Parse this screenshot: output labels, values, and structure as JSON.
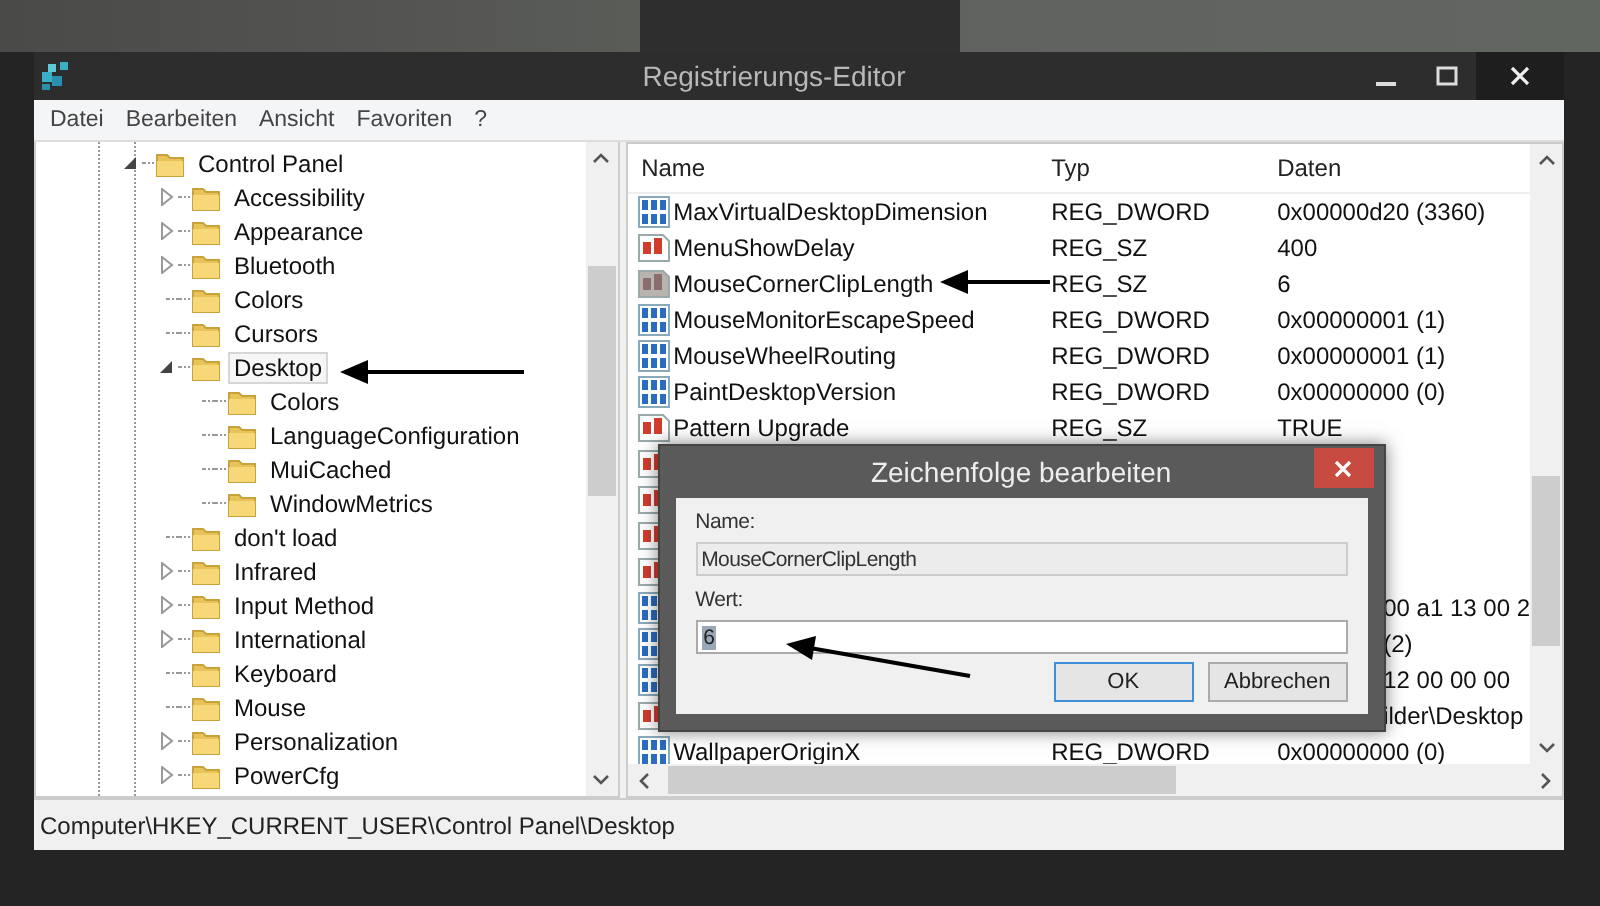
{
  "window": {
    "title": "Registrierungs-Editor"
  },
  "menu": [
    "Datei",
    "Bearbeiten",
    "Ansicht",
    "Favoriten",
    "?"
  ],
  "tree": [
    {
      "label": "Control Panel",
      "kind": "branch",
      "expanded": true,
      "selected": false,
      "children": [
        {
          "label": "Accessibility",
          "kind": "branch",
          "expanded": false,
          "selected": false
        },
        {
          "label": "Appearance",
          "kind": "branch",
          "expanded": false,
          "selected": false
        },
        {
          "label": "Bluetooth",
          "kind": "branch",
          "expanded": false,
          "selected": false
        },
        {
          "label": "Colors",
          "kind": "leaf",
          "selected": false
        },
        {
          "label": "Cursors",
          "kind": "leaf",
          "selected": false
        },
        {
          "label": "Desktop",
          "kind": "branch",
          "expanded": true,
          "selected": true,
          "children": [
            {
              "label": "Colors",
              "kind": "leaf",
              "selected": false
            },
            {
              "label": "LanguageConfiguration",
              "kind": "leaf",
              "selected": false
            },
            {
              "label": "MuiCached",
              "kind": "leaf",
              "selected": false
            },
            {
              "label": "WindowMetrics",
              "kind": "leaf",
              "selected": false
            }
          ]
        },
        {
          "label": "don't load",
          "kind": "leaf",
          "selected": false
        },
        {
          "label": "Infrared",
          "kind": "branch",
          "expanded": false,
          "selected": false
        },
        {
          "label": "Input Method",
          "kind": "branch",
          "expanded": false,
          "selected": false
        },
        {
          "label": "International",
          "kind": "branch",
          "expanded": false,
          "selected": false
        },
        {
          "label": "Keyboard",
          "kind": "leaf",
          "selected": false
        },
        {
          "label": "Mouse",
          "kind": "leaf",
          "selected": false
        },
        {
          "label": "Personalization",
          "kind": "branch",
          "expanded": false,
          "selected": false
        },
        {
          "label": "PowerCfg",
          "kind": "branch",
          "expanded": false,
          "selected": false
        }
      ]
    }
  ],
  "list": {
    "columns": [
      "Name",
      "Typ",
      "Daten"
    ],
    "rows": [
      {
        "kind": "dword",
        "name": "MaxVirtualDesktopDimension",
        "type": "REG_DWORD",
        "data": "0x00000d20 (3360)",
        "covered": false,
        "selected": false
      },
      {
        "kind": "sz",
        "name": "MenuShowDelay",
        "type": "REG_SZ",
        "data": "400",
        "covered": false,
        "selected": false
      },
      {
        "kind": "sz",
        "name": "MouseCornerClipLength",
        "type": "REG_SZ",
        "data": "6",
        "covered": false,
        "selected": true
      },
      {
        "kind": "dword",
        "name": "MouseMonitorEscapeSpeed",
        "type": "REG_DWORD",
        "data": "0x00000001 (1)",
        "covered": false,
        "selected": false
      },
      {
        "kind": "dword",
        "name": "MouseWheelRouting",
        "type": "REG_DWORD",
        "data": "0x00000001 (1)",
        "covered": false,
        "selected": false
      },
      {
        "kind": "dword",
        "name": "PaintDesktopVersion",
        "type": "REG_DWORD",
        "data": "0x00000000 (0)",
        "covered": false,
        "selected": false
      },
      {
        "kind": "sz",
        "name": "Pattern Upgrade",
        "type": "REG_SZ",
        "data": "TRUE",
        "covered": false,
        "selected": false
      },
      {
        "kind": "sz",
        "covered": true,
        "selected": false
      },
      {
        "kind": "sz",
        "covered": true,
        "selected": false
      },
      {
        "kind": "sz",
        "covered": true,
        "selected": false
      },
      {
        "kind": "sz",
        "covered": true,
        "selected": false
      },
      {
        "kind": "dword",
        "data": "00 a1 13 00 2",
        "covered": true,
        "selected": false
      },
      {
        "kind": "dword",
        "data": "(2)",
        "covered": true,
        "selected": false
      },
      {
        "kind": "dword",
        "data": "12 00 00 00",
        "covered": true,
        "selected": false
      },
      {
        "kind": "sz",
        "data": "ilder\\Desktop",
        "covered": true,
        "selected": false
      },
      {
        "kind": "dword",
        "name": "WallpaperOriginX",
        "type": "REG_DWORD",
        "data": "0x00000000 (0)",
        "covered": false,
        "selected": false
      }
    ]
  },
  "dialog": {
    "title": "Zeichenfolge bearbeiten",
    "name_label": "Name:",
    "name_value": "MouseCornerClipLength",
    "value_label": "Wert:",
    "value": "6",
    "value_selected": true,
    "buttons": [
      {
        "label": "OK",
        "default": true
      },
      {
        "label": "Abbrechen",
        "default": false
      }
    ]
  },
  "status_bar": "Computer\\HKEY_CURRENT_USER\\Control Panel\\Desktop"
}
